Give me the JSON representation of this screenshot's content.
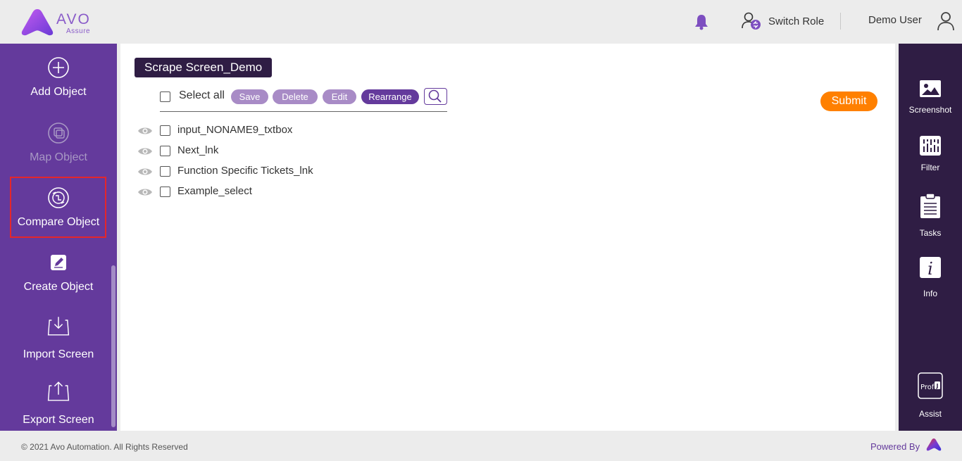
{
  "header": {
    "logo_text": "AVO",
    "logo_sub": "Assure",
    "switch_role": "Switch Role",
    "user_name": "Demo User"
  },
  "left_nav": [
    {
      "label": "Add Object",
      "icon": "plus-circle-icon",
      "enabled": true
    },
    {
      "label": "Map Object",
      "icon": "map-object-icon",
      "enabled": false
    },
    {
      "label": "Compare Object",
      "icon": "compare-object-icon",
      "enabled": true,
      "highlighted": true
    },
    {
      "label": "Create Object",
      "icon": "edit-icon",
      "enabled": true
    },
    {
      "label": "Import Screen",
      "icon": "import-icon",
      "enabled": true
    },
    {
      "label": "Export Screen",
      "icon": "export-icon",
      "enabled": true
    }
  ],
  "main": {
    "screen_name": "Scrape Screen_Demo",
    "select_all_label": "Select all",
    "buttons": {
      "save": "Save",
      "delete": "Delete",
      "edit": "Edit",
      "rearrange": "Rearrange",
      "submit": "Submit"
    },
    "objects": [
      {
        "name": "input_NONAME9_txtbox"
      },
      {
        "name": "Next_lnk"
      },
      {
        "name": "Function Specific Tickets_lnk"
      },
      {
        "name": "Example_select"
      }
    ]
  },
  "right_nav": [
    {
      "label": "Screenshot",
      "icon": "image-icon"
    },
    {
      "label": "Filter",
      "icon": "filter-icon"
    },
    {
      "label": "Tasks",
      "icon": "clipboard-icon"
    },
    {
      "label": "Info",
      "icon": "info-icon"
    },
    {
      "label": "Assist",
      "icon": "profj-icon",
      "icon_text": "Prof"
    }
  ],
  "footer": {
    "copyright": "© 2021 Avo Automation. All Rights Reserved",
    "powered_by": "Powered By"
  },
  "colors": {
    "sidebar_purple": "#643a9c",
    "right_sidebar": "#2f1d44",
    "submit_orange": "#ff8000",
    "pill_light": "#a88bc6",
    "highlight_red": "#e5262b"
  }
}
